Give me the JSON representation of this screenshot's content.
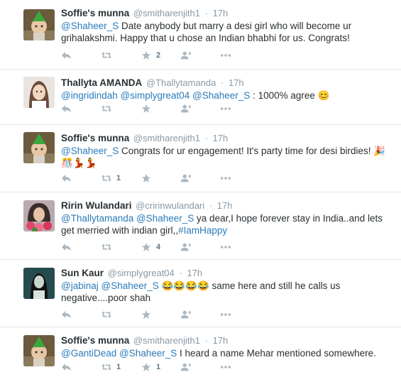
{
  "colors": {
    "link": "#2b7bb9",
    "meta": "#8899a6",
    "text": "#292f33",
    "action_icon": "#aab8c2",
    "divider": "#e1e8ed"
  },
  "tweets": [
    {
      "name": "Soffie's munna",
      "handle": "@smitharenjith1",
      "time": "17h",
      "text_parts": [
        {
          "t": "@Shaheer_S",
          "kind": "mention"
        },
        {
          "t": " Date anybody but marry a desi girl who will become ur grihalakshmi. Happy that u chose an Indian bhabhi for us. Congrats!",
          "kind": "text"
        }
      ],
      "retweet_count": "",
      "like_count": "2",
      "avatar_icon": "avatar-child-green-hat"
    },
    {
      "name": "Thallyta AMANDA",
      "handle": "@Thallytamanda",
      "time": "17h",
      "text_parts": [
        {
          "t": "@ingridindah",
          "kind": "mention"
        },
        {
          "t": " ",
          "kind": "text"
        },
        {
          "t": "@simplygreat04",
          "kind": "mention"
        },
        {
          "t": " ",
          "kind": "text"
        },
        {
          "t": "@Shaheer_S",
          "kind": "mention"
        },
        {
          "t": " : 1000% agree 😊",
          "kind": "text"
        }
      ],
      "retweet_count": "",
      "like_count": "",
      "avatar_icon": "avatar-woman-light"
    },
    {
      "name": "Soffie's munna",
      "handle": "@smitharenjith1",
      "time": "17h",
      "text_parts": [
        {
          "t": "@Shaheer_S",
          "kind": "mention"
        },
        {
          "t": " Congrats for ur engagement! It's party time for desi birdies! 🎉🎊💃💃",
          "kind": "text"
        }
      ],
      "retweet_count": "1",
      "like_count": "",
      "avatar_icon": "avatar-child-green-hat"
    },
    {
      "name": "Ririn Wulandari",
      "handle": "@cririnwulandari",
      "time": "17h",
      "text_parts": [
        {
          "t": "@Thallytamanda",
          "kind": "mention"
        },
        {
          "t": " ",
          "kind": "text"
        },
        {
          "t": "@Shaheer_S",
          "kind": "mention"
        },
        {
          "t": " ya dear,I hope forever stay in India..and lets get merried with indian girl,,",
          "kind": "text"
        },
        {
          "t": "#IamHappy",
          "kind": "hashtag"
        }
      ],
      "retweet_count": "",
      "like_count": "4",
      "avatar_icon": "avatar-woman-flowers"
    },
    {
      "name": "Sun Kaur",
      "handle": "@simplygreat04",
      "time": "17h",
      "text_parts": [
        {
          "t": "@jabinaj",
          "kind": "mention"
        },
        {
          "t": " ",
          "kind": "text"
        },
        {
          "t": "@Shaheer_S",
          "kind": "mention"
        },
        {
          "t": " 😂😂😂😂 same here and still he calls us negative....poor shah",
          "kind": "text"
        }
      ],
      "retweet_count": "",
      "like_count": "",
      "avatar_icon": "avatar-dark-teal"
    },
    {
      "name": "Soffie's munna",
      "handle": "@smitharenjith1",
      "time": "17h",
      "text_parts": [
        {
          "t": "@GantiDead",
          "kind": "mention"
        },
        {
          "t": " ",
          "kind": "text"
        },
        {
          "t": "@Shaheer_S",
          "kind": "mention"
        },
        {
          "t": " I heard a name Mehar mentioned somewhere.",
          "kind": "text"
        }
      ],
      "retweet_count": "1",
      "like_count": "1",
      "avatar_icon": "avatar-child-green-hat"
    }
  ]
}
